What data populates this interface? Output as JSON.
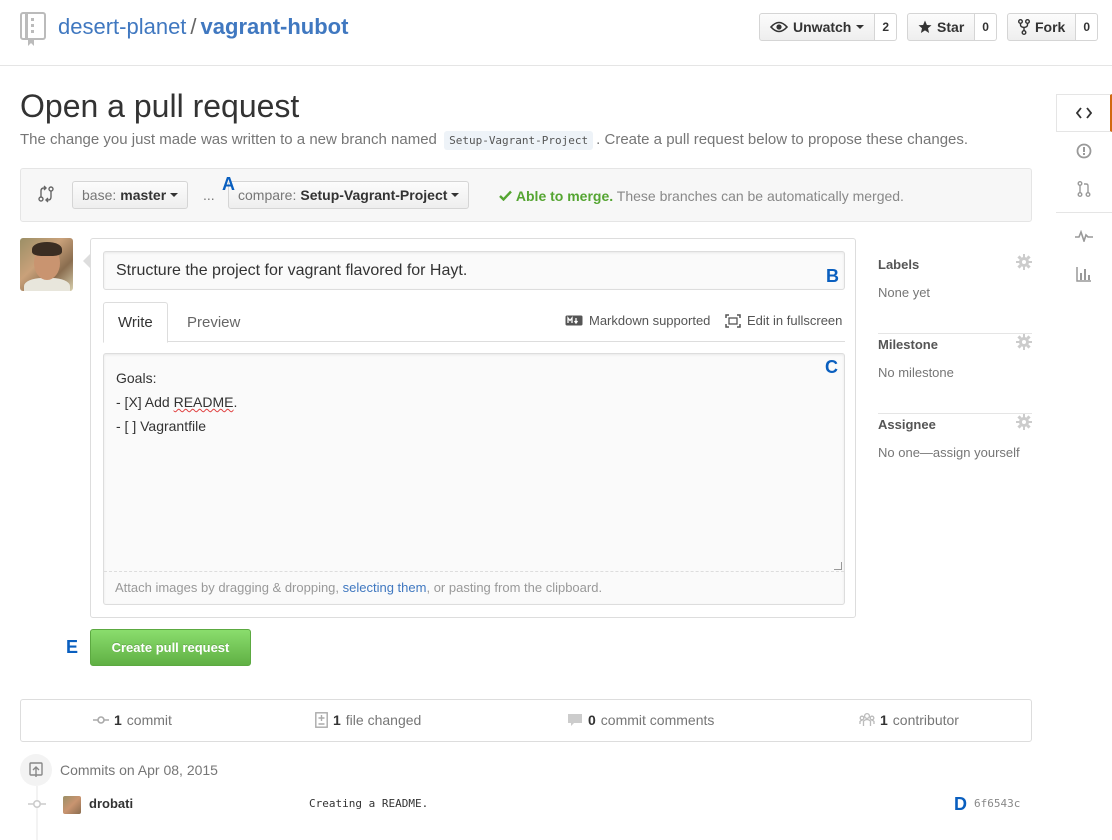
{
  "header": {
    "owner": "desert-planet",
    "separator": "/",
    "repo": "vagrant-hubot",
    "actions": [
      {
        "label": "Unwatch",
        "count": "2",
        "icon": "eye-icon"
      },
      {
        "label": "Star",
        "count": "0",
        "icon": "star-icon"
      },
      {
        "label": "Fork",
        "count": "0",
        "icon": "fork-icon"
      }
    ]
  },
  "page": {
    "title": "Open a pull request",
    "lead_prefix": "The change you just made was written to a new branch named",
    "branch_name": "Setup-Vagrant-Project",
    "lead_suffix": ". Create a pull request below to propose these changes."
  },
  "range": {
    "base_prefix": "base:",
    "base_value": "master",
    "dots": "...",
    "compare_prefix": "compare:",
    "compare_value": "Setup-Vagrant-Project",
    "merge_ok": "Able to merge.",
    "merge_text": "These branches can be automatically merged."
  },
  "markers": {
    "a": "A",
    "b": "B",
    "c": "C",
    "d": "D",
    "e": "E"
  },
  "form": {
    "title_value": "Structure the project for vagrant flavored for Hayt.",
    "tab_write": "Write",
    "tab_preview": "Preview",
    "markdown_label": "Markdown supported",
    "fullscreen_label": "Edit in fullscreen",
    "body_line1": "Goals:",
    "body_line2_prefix": "- [X] Add ",
    "body_line2_word": "README",
    "body_line2_suffix": ".",
    "body_line3": "- [ ] Vagrantfile",
    "attach_prefix": "Attach images by dragging & dropping, ",
    "attach_link": "selecting them",
    "attach_suffix": ", or pasting from the clipboard."
  },
  "sidebar": {
    "items": [
      {
        "label": "Labels",
        "value": "None yet"
      },
      {
        "label": "Milestone",
        "value": "No milestone"
      },
      {
        "label": "Assignee",
        "value": "No one—assign yourself"
      }
    ]
  },
  "submit": {
    "label": "Create pull request"
  },
  "summary": {
    "commits_count": "1",
    "commits_label": "commit",
    "files_count": "1",
    "files_label": "file changed",
    "comments_count": "0",
    "comments_label": "commit comments",
    "contributors_count": "1",
    "contributors_label": "contributor"
  },
  "commits": {
    "date_label": "Commits on Apr 08, 2015",
    "items": [
      {
        "author": "drobati",
        "message": "Creating a README.",
        "sha": "6f6543c"
      }
    ]
  },
  "colors": {
    "accent": "#4078c0",
    "success": "#55a532",
    "nav_highlight": "#d26911",
    "marker": "#0a5fbf"
  }
}
